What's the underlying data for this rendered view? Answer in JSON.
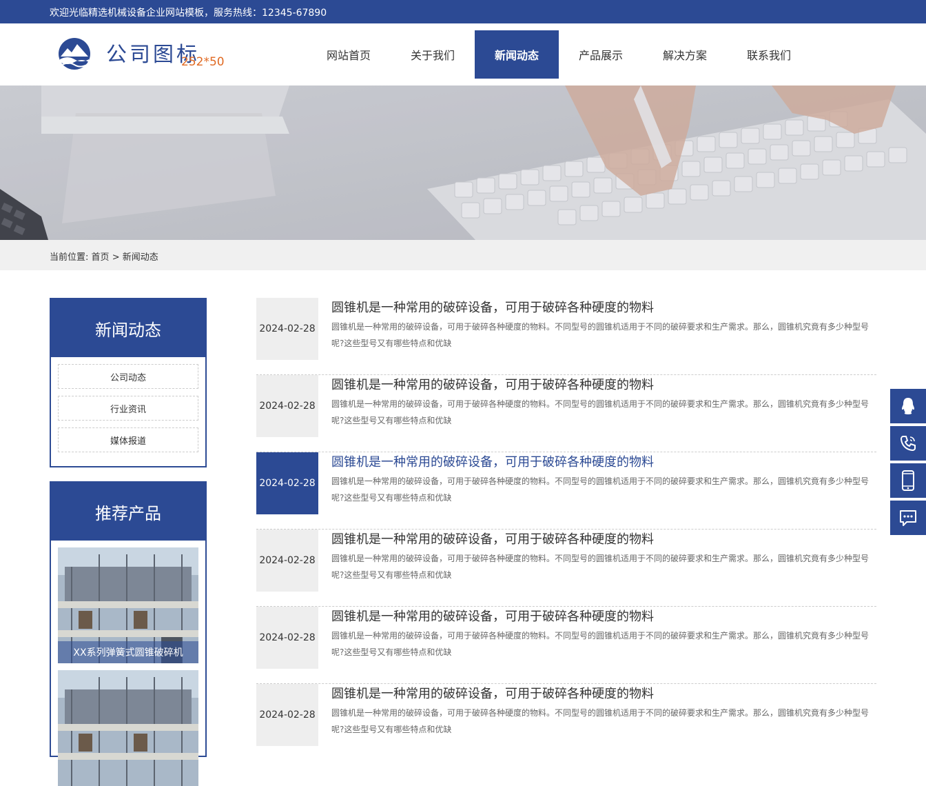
{
  "topbar": {
    "welcome": "欢迎光临精选机械设备企业网站模板，服务热线：12345-67890"
  },
  "logo": {
    "text": "公司图标",
    "size_note": "252*50"
  },
  "nav": {
    "items": [
      "网站首页",
      "关于我们",
      "新闻动态",
      "产品展示",
      "解决方案",
      "联系我们"
    ],
    "active": "新闻动态"
  },
  "breadcrumb": {
    "prefix": "当前位置:",
    "home": "首页",
    "separator": ">",
    "current": "新闻动态"
  },
  "sidebar": {
    "news_title": "新闻动态",
    "categories": [
      "公司动态",
      "行业资讯",
      "媒体报道"
    ],
    "products_title": "推荐产品",
    "products": [
      {
        "name": "XX系列弹簧式圆锥破碎机"
      },
      {
        "name": ""
      }
    ]
  },
  "news": [
    {
      "date": "2024-02-28",
      "title": "圆锥机是一种常用的破碎设备，可用于破碎各种硬度的物料",
      "desc": "圆锥机是一种常用的破碎设备，可用于破碎各种硬度的物料。不同型号的圆锥机适用于不同的破碎要求和生产需求。那么，圆锥机究竟有多少种型号呢?这些型号又有哪些特点和优缺"
    },
    {
      "date": "2024-02-28",
      "title": "圆锥机是一种常用的破碎设备，可用于破碎各种硬度的物料",
      "desc": "圆锥机是一种常用的破碎设备，可用于破碎各种硬度的物料。不同型号的圆锥机适用于不同的破碎要求和生产需求。那么，圆锥机究竟有多少种型号呢?这些型号又有哪些特点和优缺"
    },
    {
      "date": "2024-02-28",
      "title": "圆锥机是一种常用的破碎设备，可用于破碎各种硬度的物料",
      "desc": "圆锥机是一种常用的破碎设备，可用于破碎各种硬度的物料。不同型号的圆锥机适用于不同的破碎要求和生产需求。那么，圆锥机究竟有多少种型号呢?这些型号又有哪些特点和优缺"
    },
    {
      "date": "2024-02-28",
      "title": "圆锥机是一种常用的破碎设备，可用于破碎各种硬度的物料",
      "desc": "圆锥机是一种常用的破碎设备，可用于破碎各种硬度的物料。不同型号的圆锥机适用于不同的破碎要求和生产需求。那么，圆锥机究竟有多少种型号呢?这些型号又有哪些特点和优缺"
    },
    {
      "date": "2024-02-28",
      "title": "圆锥机是一种常用的破碎设备，可用于破碎各种硬度的物料",
      "desc": "圆锥机是一种常用的破碎设备，可用于破碎各种硬度的物料。不同型号的圆锥机适用于不同的破碎要求和生产需求。那么，圆锥机究竟有多少种型号呢?这些型号又有哪些特点和优缺"
    },
    {
      "date": "2024-02-28",
      "title": "圆锥机是一种常用的破碎设备，可用于破碎各种硬度的物料",
      "desc": "圆锥机是一种常用的破碎设备，可用于破碎各种硬度的物料。不同型号的圆锥机适用于不同的破碎要求和生产需求。那么，圆锥机究竟有多少种型号呢?这些型号又有哪些特点和优缺"
    }
  ],
  "active_news_index": 2,
  "float_icons": [
    "qq-icon",
    "phone-icon",
    "mobile-icon",
    "chat-icon"
  ],
  "colors": {
    "brand": "#2c4a94",
    "accent": "#e06a23"
  }
}
